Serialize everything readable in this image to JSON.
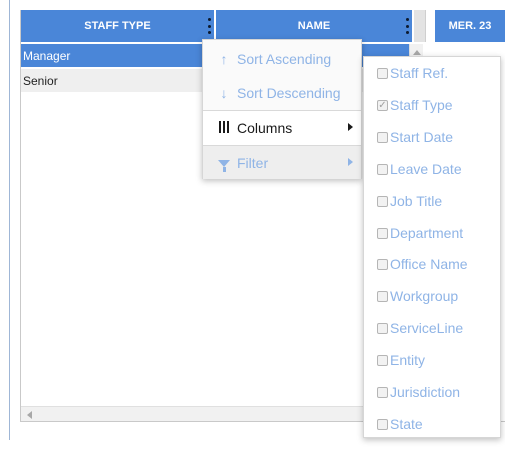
{
  "grid": {
    "columns": [
      {
        "label": "STAFF TYPE"
      },
      {
        "label": "NAME"
      },
      {
        "label": "MER. 23"
      }
    ],
    "rows": [
      {
        "staff_type": "Manager",
        "selected": true
      },
      {
        "staff_type": "Senior",
        "selected": false
      }
    ]
  },
  "context_menu": {
    "sort_ascending": "Sort Ascending",
    "sort_descending": "Sort Descending",
    "columns": "Columns",
    "filter": "Filter"
  },
  "columns_submenu": {
    "items": [
      {
        "label": "Staff Ref.",
        "checked": false
      },
      {
        "label": "Staff Type",
        "checked": true
      },
      {
        "label": "Start Date",
        "checked": false
      },
      {
        "label": "Leave Date",
        "checked": false
      },
      {
        "label": "Job Title",
        "checked": false
      },
      {
        "label": "Department",
        "checked": false
      },
      {
        "label": "Office Name",
        "checked": false
      },
      {
        "label": "Workgroup",
        "checked": false
      },
      {
        "label": "ServiceLine",
        "checked": false
      },
      {
        "label": "Entity",
        "checked": false
      },
      {
        "label": "Jurisdiction",
        "checked": false
      },
      {
        "label": "State",
        "checked": false
      }
    ]
  },
  "icons": {
    "sort_ascending": "↑",
    "sort_descending": "↓",
    "checkmark": "✓",
    "columns": "columns-icon",
    "filter": "funnel-icon",
    "kebab": "kebab-menu-icon"
  },
  "colors": {
    "header_blue": "#4a86d8",
    "menu_disabled_text": "#8fb4e6",
    "selected_row": "#4a86d8"
  }
}
